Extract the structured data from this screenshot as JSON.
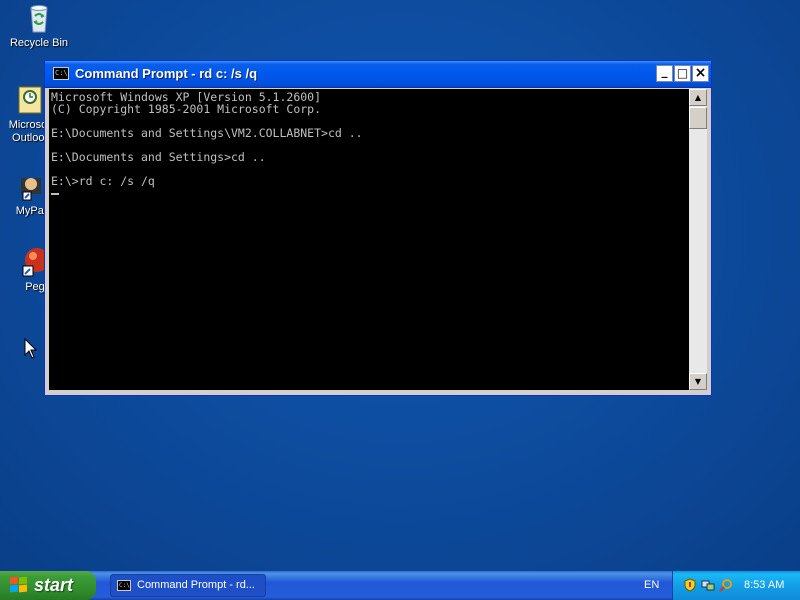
{
  "desktop": {
    "icons": [
      {
        "label": "Recycle Bin",
        "icon": "recycle-bin-icon"
      },
      {
        "label": "Microsoft Outlook",
        "icon": "outlook-icon"
      },
      {
        "label": "MyPal",
        "icon": "mypal-icon"
      },
      {
        "label": "Peg",
        "icon": "peg-icon"
      }
    ]
  },
  "window": {
    "title": "Command Prompt - rd c: /s /q",
    "buttons": {
      "minimize": "_",
      "maximize": "□",
      "close": "×"
    },
    "console_lines": [
      "Microsoft Windows XP [Version 5.1.2600]",
      "(C) Copyright 1985-2001 Microsoft Corp.",
      "",
      "E:\\Documents and Settings\\VM2.COLLABNET>cd ..",
      "",
      "E:\\Documents and Settings>cd ..",
      "",
      "E:\\>rd c: /s /q"
    ]
  },
  "taskbar": {
    "start_label": "start",
    "task_label": "Command Prompt - rd...",
    "language": "EN",
    "clock": "8:53 AM"
  },
  "colors": {
    "desktop": "#0d4a9c",
    "titlebar": "#0058ee",
    "console_bg": "#000000",
    "console_fg": "#c0c0c0",
    "start_green": "#3c9c38"
  }
}
